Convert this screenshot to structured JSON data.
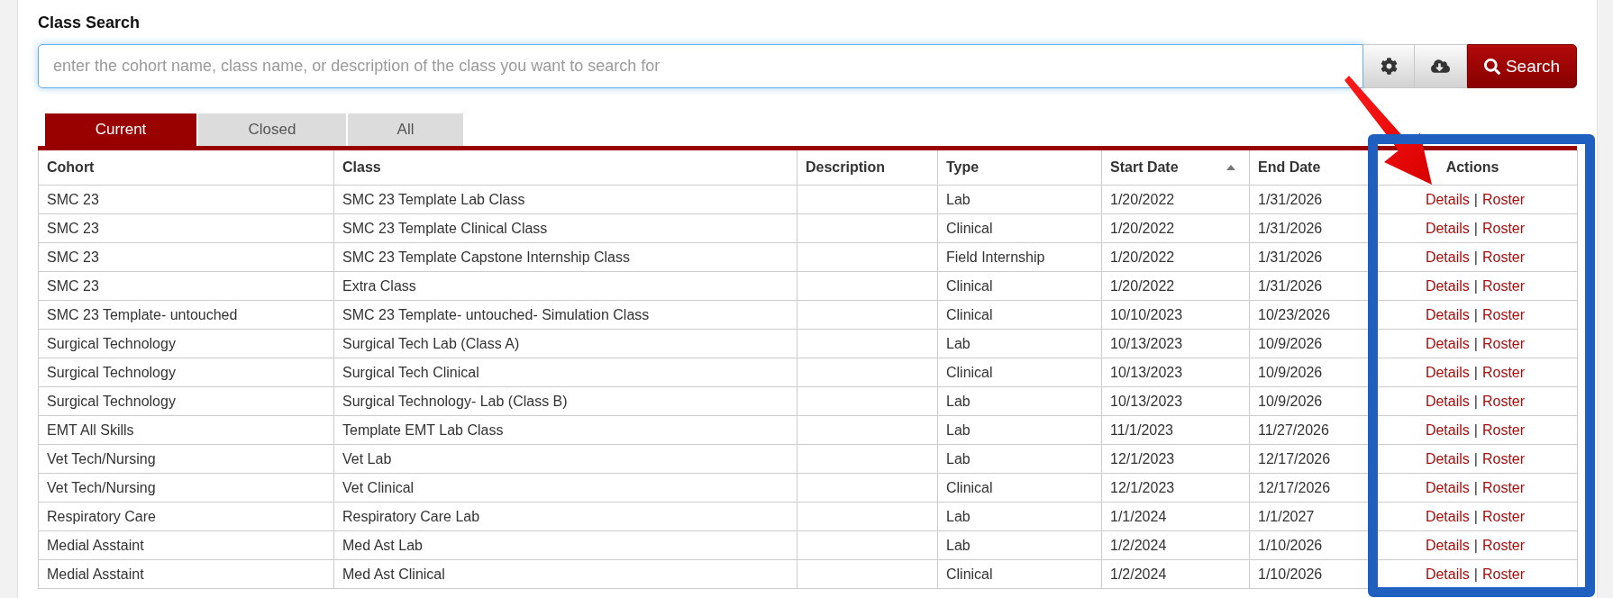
{
  "page": {
    "title": "Class Search"
  },
  "search": {
    "placeholder": "enter the cohort name, class name, or description of the class you want to search for",
    "buttons": [
      {
        "kind": "settings"
      },
      {
        "kind": "download"
      },
      {
        "kind": "search",
        "label": "Search"
      }
    ]
  },
  "tabs": [
    {
      "label": "Current",
      "selected": true
    },
    {
      "label": "Closed",
      "selected": false
    },
    {
      "label": "All",
      "selected": false
    }
  ],
  "table": {
    "columns": [
      {
        "label": "Cohort",
        "sorted": false
      },
      {
        "label": "Class",
        "sorted": false
      },
      {
        "label": "Description",
        "sorted": false
      },
      {
        "label": "Type",
        "sorted": false
      },
      {
        "label": "Start Date",
        "sorted": true
      },
      {
        "label": "End Date",
        "sorted": false
      },
      {
        "label": "Actions",
        "sorted": false
      }
    ],
    "rows": [
      {
        "cohort": "SMC 23",
        "class": "SMC 23 Template Lab Class",
        "type": "Lab",
        "start_date": "1/20/2022",
        "end_date": "1/31/2026",
        "actions": [
          {
            "kind": "link",
            "label": "Details"
          },
          {
            "kind": "separator",
            "label": "|"
          },
          {
            "kind": "link",
            "label": "Roster"
          }
        ]
      },
      {
        "cohort": "SMC 23",
        "class": "SMC 23 Template Clinical Class",
        "type": "Clinical",
        "start_date": "1/20/2022",
        "end_date": "1/31/2026",
        "actions": [
          {
            "kind": "link",
            "label": "Details"
          },
          {
            "kind": "separator",
            "label": "|"
          },
          {
            "kind": "link",
            "label": "Roster"
          }
        ]
      },
      {
        "cohort": "SMC 23",
        "class": "SMC 23 Template Capstone Internship Class",
        "type": "Field Internship",
        "start_date": "1/20/2022",
        "end_date": "1/31/2026",
        "actions": [
          {
            "kind": "link",
            "label": "Details"
          },
          {
            "kind": "separator",
            "label": "|"
          },
          {
            "kind": "link",
            "label": "Roster"
          }
        ]
      },
      {
        "cohort": "SMC 23",
        "class": "Extra Class",
        "type": "Clinical",
        "start_date": "1/20/2022",
        "end_date": "1/31/2026",
        "actions": [
          {
            "kind": "link",
            "label": "Details"
          },
          {
            "kind": "separator",
            "label": "|"
          },
          {
            "kind": "link",
            "label": "Roster"
          }
        ]
      },
      {
        "cohort": "SMC 23 Template- untouched",
        "class": "SMC 23 Template- untouched- Simulation Class",
        "type": "Clinical",
        "start_date": "10/10/2023",
        "end_date": "10/23/2026",
        "actions": [
          {
            "kind": "link",
            "label": "Details"
          },
          {
            "kind": "separator",
            "label": "|"
          },
          {
            "kind": "link",
            "label": "Roster"
          }
        ]
      },
      {
        "cohort": "Surgical Technology",
        "class": "Surgical Tech Lab (Class A)",
        "type": "Lab",
        "start_date": "10/13/2023",
        "end_date": "10/9/2026",
        "actions": [
          {
            "kind": "link",
            "label": "Details"
          },
          {
            "kind": "separator",
            "label": "|"
          },
          {
            "kind": "link",
            "label": "Roster"
          }
        ]
      },
      {
        "cohort": "Surgical Technology",
        "class": "Surgical Tech Clinical",
        "type": "Clinical",
        "start_date": "10/13/2023",
        "end_date": "10/9/2026",
        "actions": [
          {
            "kind": "link",
            "label": "Details"
          },
          {
            "kind": "separator",
            "label": "|"
          },
          {
            "kind": "link",
            "label": "Roster"
          }
        ]
      },
      {
        "cohort": "Surgical Technology",
        "class": "Surgical Technology- Lab (Class B)",
        "type": "Lab",
        "start_date": "10/13/2023",
        "end_date": "10/9/2026",
        "actions": [
          {
            "kind": "link",
            "label": "Details"
          },
          {
            "kind": "separator",
            "label": "|"
          },
          {
            "kind": "link",
            "label": "Roster"
          }
        ]
      },
      {
        "cohort": "EMT All Skills",
        "class": "Template EMT Lab Class",
        "type": "Lab",
        "start_date": "11/1/2023",
        "end_date": "11/27/2026",
        "actions": [
          {
            "kind": "link",
            "label": "Details"
          },
          {
            "kind": "separator",
            "label": "|"
          },
          {
            "kind": "link",
            "label": "Roster"
          }
        ]
      },
      {
        "cohort": "Vet Tech/Nursing",
        "class": "Vet Lab",
        "type": "Lab",
        "start_date": "12/1/2023",
        "end_date": "12/17/2026",
        "actions": [
          {
            "kind": "link",
            "label": "Details"
          },
          {
            "kind": "separator",
            "label": "|"
          },
          {
            "kind": "link",
            "label": "Roster"
          }
        ]
      },
      {
        "cohort": "Vet Tech/Nursing",
        "class": "Vet Clinical",
        "type": "Clinical",
        "start_date": "12/1/2023",
        "end_date": "12/17/2026",
        "actions": [
          {
            "kind": "link",
            "label": "Details"
          },
          {
            "kind": "separator",
            "label": "|"
          },
          {
            "kind": "link",
            "label": "Roster"
          }
        ]
      },
      {
        "cohort": "Respiratory Care",
        "class": "Respiratory Care Lab",
        "type": "Lab",
        "start_date": "1/1/2024",
        "end_date": "1/1/2027",
        "actions": [
          {
            "kind": "link",
            "label": "Details"
          },
          {
            "kind": "separator",
            "label": "|"
          },
          {
            "kind": "link",
            "label": "Roster"
          }
        ]
      },
      {
        "cohort": "Medial Asstaint",
        "class": "Med Ast Lab",
        "type": "Lab",
        "start_date": "1/2/2024",
        "end_date": "1/10/2026",
        "actions": [
          {
            "kind": "link",
            "label": "Details"
          },
          {
            "kind": "separator",
            "label": "|"
          },
          {
            "kind": "link",
            "label": "Roster"
          }
        ]
      },
      {
        "cohort": "Medial Asstaint",
        "class": "Med Ast Clinical",
        "type": "Clinical",
        "start_date": "1/2/2024",
        "end_date": "1/10/2026",
        "actions": [
          {
            "kind": "link",
            "label": "Details"
          },
          {
            "kind": "separator",
            "label": "|"
          },
          {
            "kind": "link",
            "label": "Roster"
          }
        ]
      }
    ]
  },
  "annotations": [
    {
      "kind": "arrow"
    },
    {
      "kind": "frame"
    }
  ]
}
